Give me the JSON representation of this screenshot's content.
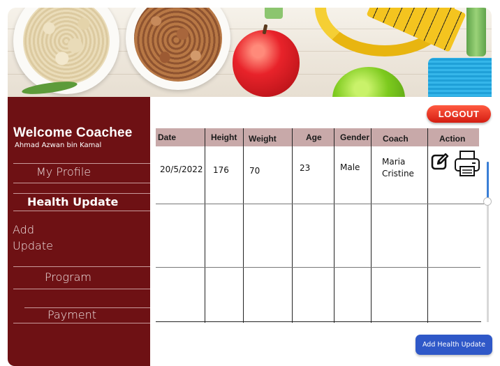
{
  "sidebar": {
    "welcome": "Welcome Coachee",
    "user_name": "Ahmad Azwan bin Kamal",
    "nav": {
      "profile": "My Profile",
      "health_update": "Health Update",
      "add_update_line1": "Add",
      "add_update_line2": "Update",
      "program": "Program",
      "payment": "Payment"
    },
    "background": "#6e1114"
  },
  "header": {
    "logout_label": "LOGOUT"
  },
  "table": {
    "columns": [
      "Date",
      "Height",
      "Weight",
      "Age",
      "Gender",
      "Coach",
      "Action"
    ],
    "rows": [
      {
        "date": "20/5/2022",
        "height": "176",
        "weight": "70",
        "age": "23",
        "gender": "Male",
        "coach_line1": "Maria",
        "coach_line2": "Cristine"
      }
    ],
    "header_color": "#c8a9a9"
  },
  "actions": {
    "edit_icon": "edit-icon",
    "print_icon": "printer-icon",
    "add_health_update_label": "Add Health Update"
  },
  "colors": {
    "logout": "#e02a1c",
    "primary_button": "#2f58c8"
  }
}
